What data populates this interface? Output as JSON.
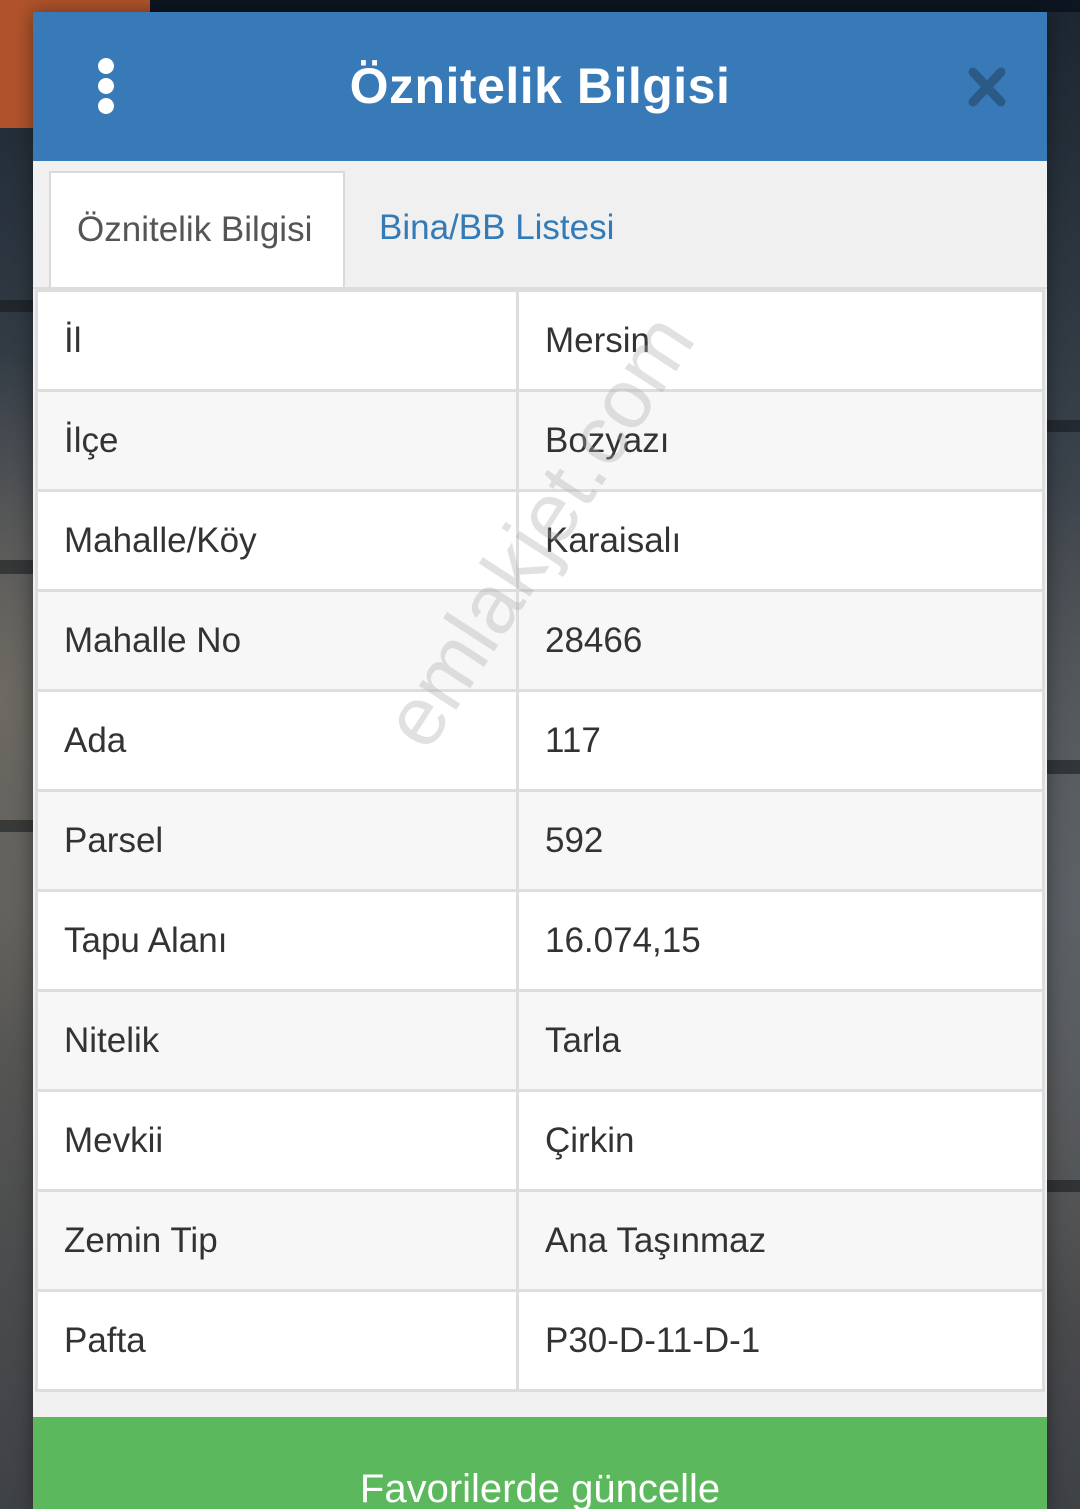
{
  "header": {
    "title": "Öznitelik Bilgisi",
    "menu_icon": "vertical-ellipsis-icon",
    "close_icon": "close-x-icon"
  },
  "tabs": [
    {
      "label": "Öznitelik Bilgisi",
      "active": true
    },
    {
      "label": "Bina/BB Listesi",
      "active": false
    }
  ],
  "attributes": [
    {
      "key": "İl",
      "value": "Mersin"
    },
    {
      "key": "İlçe",
      "value": "Bozyazı"
    },
    {
      "key": "Mahalle/Köy",
      "value": "Karaisalı"
    },
    {
      "key": "Mahalle No",
      "value": "28466"
    },
    {
      "key": "Ada",
      "value": "117"
    },
    {
      "key": "Parsel",
      "value": "592"
    },
    {
      "key": "Tapu Alanı",
      "value": "16.074,15"
    },
    {
      "key": "Nitelik",
      "value": "Tarla"
    },
    {
      "key": "Mevkii",
      "value": "Çirkin"
    },
    {
      "key": "Zemin Tip",
      "value": "Ana Taşınmaz"
    },
    {
      "key": "Pafta",
      "value": "P30-D-11-D-1"
    }
  ],
  "watermark": "emlakjet.com",
  "footer": {
    "update_button_label": "Favorilerde güncelle"
  },
  "colors": {
    "header": "#377ab7",
    "tab_link": "#337ab7",
    "button": "#5cb85c"
  }
}
